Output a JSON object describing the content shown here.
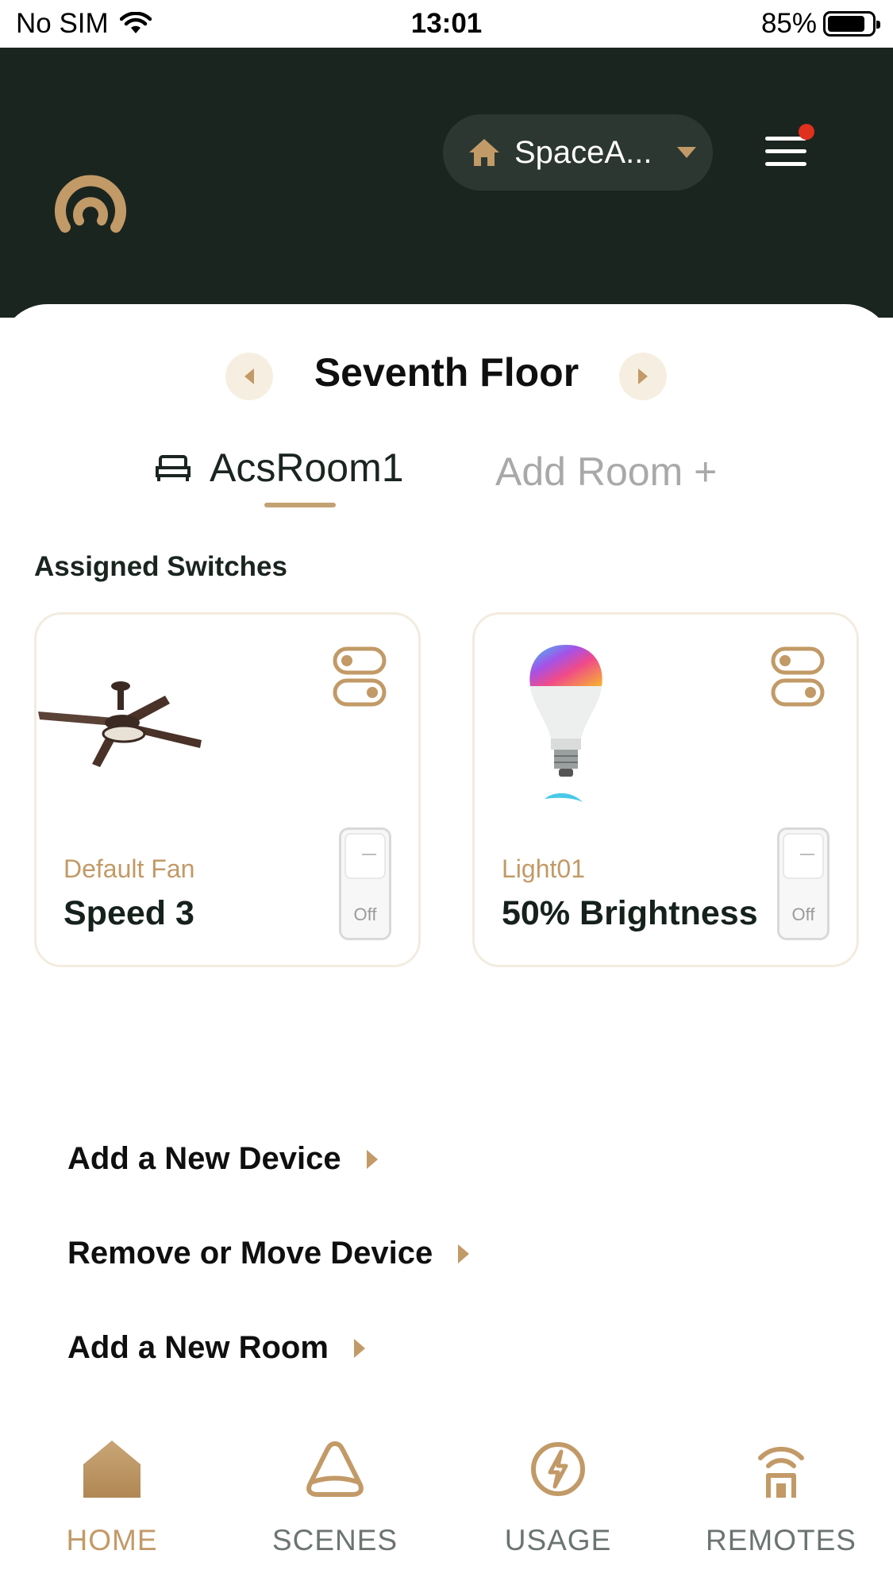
{
  "status_bar": {
    "carrier": "No SIM",
    "time": "13:01",
    "battery": "85%",
    "battery_level": 0.85
  },
  "header": {
    "space_name": "SpaceA...",
    "has_notification": true
  },
  "floor": {
    "title": "Seventh Floor"
  },
  "rooms": {
    "active": "AcsRoom1",
    "add_label": "Add Room +"
  },
  "switches": {
    "section_title": "Assigned Switches",
    "cards": [
      {
        "name": "Default Fan",
        "value": "Speed 3",
        "state": "Off",
        "icon": "ceiling-fan-image"
      },
      {
        "name": "Light01",
        "value": "50% Brightness",
        "state": "Off",
        "icon": "smart-bulb-image"
      }
    ]
  },
  "actions": [
    {
      "label": "Add a New Device"
    },
    {
      "label": "Remove or Move Device"
    },
    {
      "label": "Add a New Room"
    }
  ],
  "nav": {
    "items": [
      {
        "label": "HOME",
        "icon": "home-icon",
        "active": true
      },
      {
        "label": "SCENES",
        "icon": "scenes-icon",
        "active": false
      },
      {
        "label": "USAGE",
        "icon": "usage-icon",
        "active": false
      },
      {
        "label": "REMOTES",
        "icon": "remote-icon",
        "active": false
      }
    ]
  },
  "colors": {
    "header_bg": "#1b2520",
    "accent": "#c29a67",
    "notification": "#e0301e"
  }
}
